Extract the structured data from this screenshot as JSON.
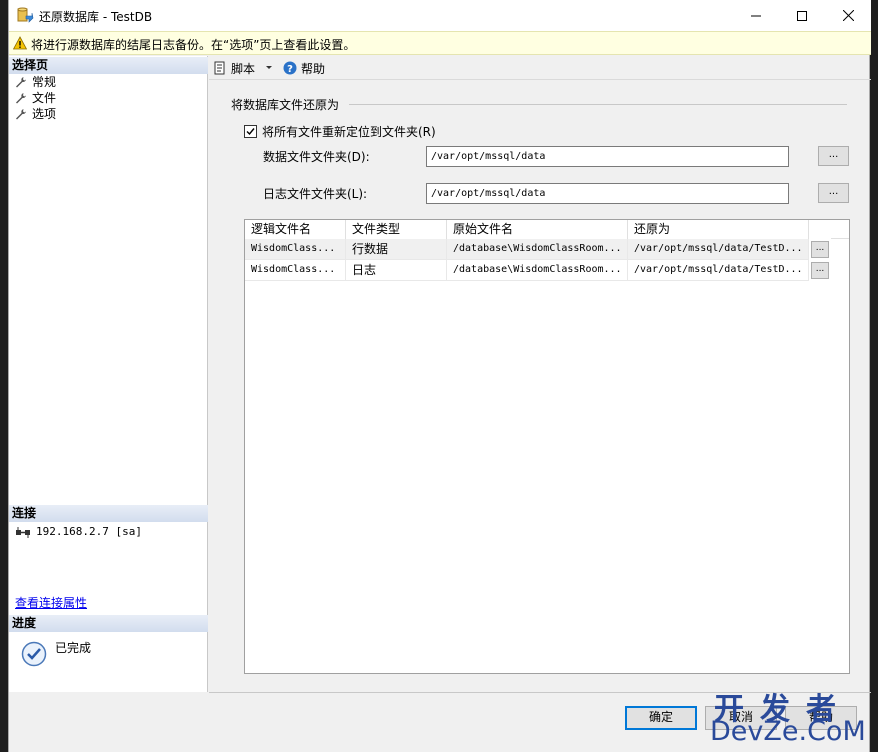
{
  "window": {
    "title": "还原数据库 - TestDB",
    "warning": "将进行源数据库的结尾日志备份。在“选项”页上查看此设置。"
  },
  "left_panel": {
    "select_page_header": "选择页",
    "pages": [
      {
        "label": "常规"
      },
      {
        "label": "文件"
      },
      {
        "label": "选项"
      }
    ],
    "connection_header": "连接",
    "connection": "192.168.2.7 [sa]",
    "connection_link": "查看连接属性",
    "progress_header": "进度",
    "progress_status": "已完成"
  },
  "toolbar": {
    "script_label": "脚本",
    "help_label": "帮助"
  },
  "restore_files": {
    "group_title": "将数据库文件还原为",
    "relocate_checkbox_label": "将所有文件重新定位到文件夹(R)",
    "relocate_checked": true,
    "data_folder_label": "数据文件文件夹(D):",
    "data_folder_value": "/var/opt/mssql/data",
    "log_folder_label": "日志文件文件夹(L):",
    "log_folder_value": "/var/opt/mssql/data",
    "browse_label": "..."
  },
  "grid": {
    "columns": [
      "逻辑文件名",
      "文件类型",
      "原始文件名",
      "还原为"
    ],
    "rows": [
      [
        "WisdomClass...",
        "行数据",
        "/database\\WisdomClassRoom...",
        "/var/opt/mssql/data/TestD..."
      ],
      [
        "WisdomClass...",
        "日志",
        "/database\\WisdomClassRoom...",
        "/var/opt/mssql/data/TestD..."
      ]
    ],
    "row_button": "..."
  },
  "buttons": {
    "ok": "确定",
    "cancel": "取消",
    "help": "帮助"
  },
  "watermark": {
    "top": "开发者",
    "bottom": "DevZe.CoM"
  }
}
